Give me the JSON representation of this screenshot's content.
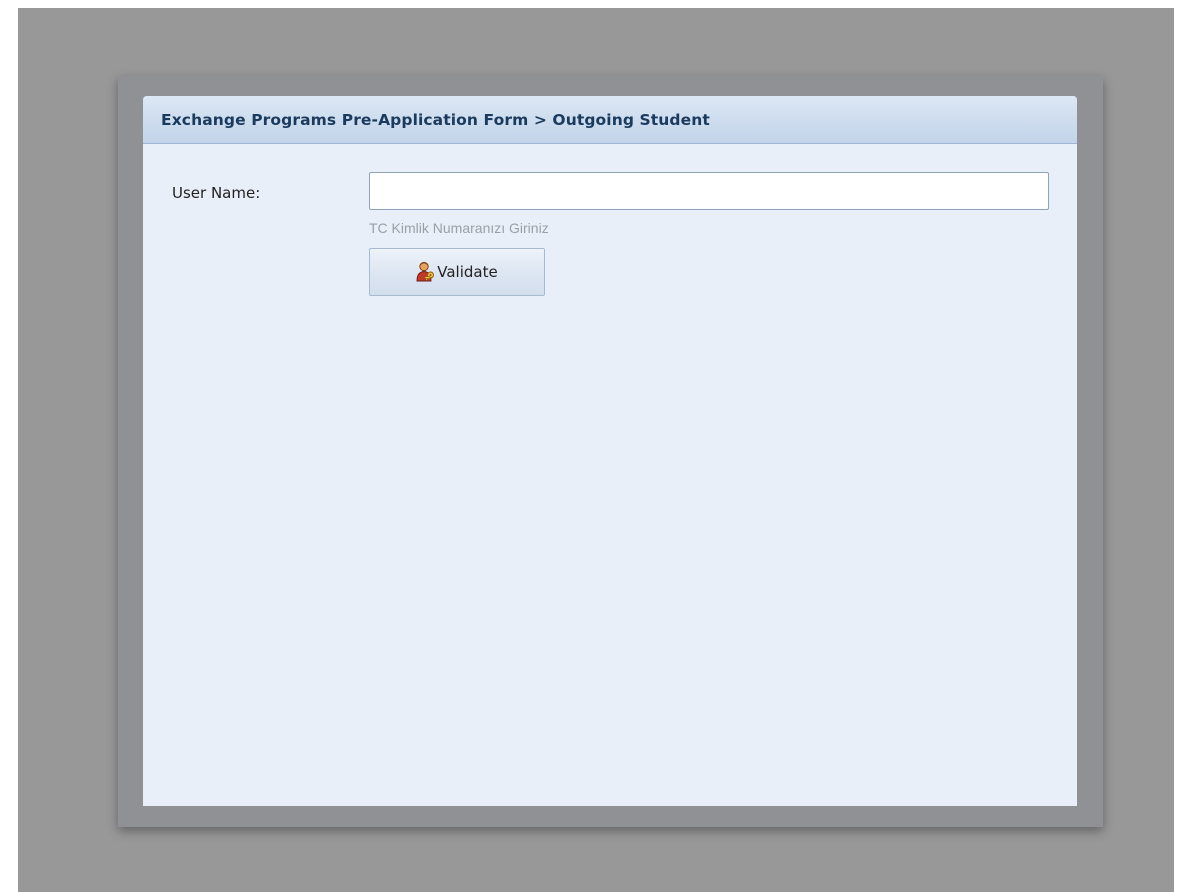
{
  "panel": {
    "title": "Exchange Programs Pre-Application Form > Outgoing Student"
  },
  "form": {
    "username_label": "User Name:",
    "username_value": "",
    "username_placeholder": "",
    "hint": "TC Kimlik Numaranızı Giriniz",
    "validate_label": "Validate",
    "validate_icon": "user-key-icon"
  },
  "colors": {
    "backdrop": "#989898",
    "panel_background": "#e8eff9",
    "header_text": "#1a3a5e",
    "hint_text": "#9aa0a6"
  }
}
